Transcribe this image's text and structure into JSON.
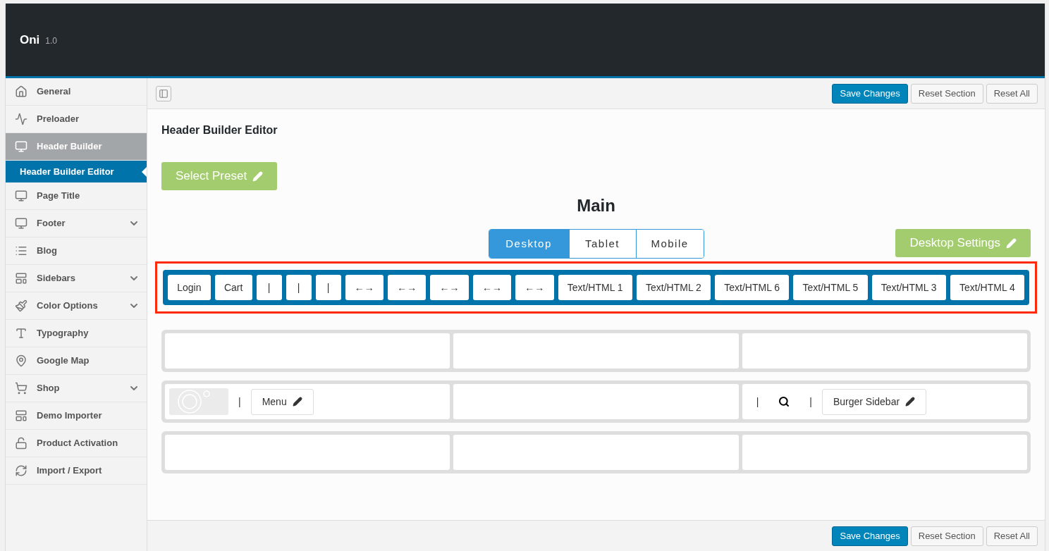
{
  "header": {
    "title": "Oni",
    "version": "1.0"
  },
  "sidebar": {
    "items": [
      {
        "label": "General",
        "kind": "home",
        "selected": false,
        "has_submenu": false
      },
      {
        "label": "Preloader",
        "kind": "chart",
        "selected": false,
        "has_submenu": false
      },
      {
        "label": "Header Builder",
        "kind": "monitor",
        "selected": true,
        "has_submenu": false,
        "children": [
          {
            "label": "Header Builder Editor",
            "selected": true
          }
        ]
      },
      {
        "label": "Page Title",
        "kind": "monitor",
        "selected": false,
        "has_submenu": false
      },
      {
        "label": "Footer",
        "kind": "monitor",
        "selected": false,
        "has_submenu": true
      },
      {
        "label": "Blog",
        "kind": "list",
        "selected": false,
        "has_submenu": false
      },
      {
        "label": "Sidebars",
        "kind": "layout",
        "selected": false,
        "has_submenu": true
      },
      {
        "label": "Color Options",
        "kind": "brush",
        "selected": false,
        "has_submenu": true
      },
      {
        "label": "Typography",
        "kind": "type",
        "selected": false,
        "has_submenu": false
      },
      {
        "label": "Google Map",
        "kind": "pin",
        "selected": false,
        "has_submenu": false
      },
      {
        "label": "Shop",
        "kind": "cart",
        "selected": false,
        "has_submenu": true
      },
      {
        "label": "Demo Importer",
        "kind": "layout",
        "selected": false,
        "has_submenu": false
      },
      {
        "label": "Product Activation",
        "kind": "unlock",
        "selected": false,
        "has_submenu": false
      },
      {
        "label": "Import / Export",
        "kind": "refresh",
        "selected": false,
        "has_submenu": false
      }
    ]
  },
  "top_actions": [
    "Save Changes",
    "Reset Section",
    "Reset All"
  ],
  "section_title": "Header Builder Editor",
  "preset_button": "Select Preset",
  "builder_title": "Main",
  "device_tabs": [
    {
      "label": "Desktop",
      "selected": true
    },
    {
      "label": "Tablet",
      "selected": false
    },
    {
      "label": "Mobile",
      "selected": false
    }
  ],
  "settings_button": "Desktop Settings",
  "available_elements": [
    "Login",
    "Cart",
    "|",
    "|",
    "|",
    "←→",
    "←→",
    "←→",
    "←→",
    "←→",
    "Text/HTML 1",
    "Text/HTML 2",
    "Text/HTML 6",
    "Text/HTML 5",
    "Text/HTML 3",
    "Text/HTML 4"
  ],
  "rows": [
    {
      "cells": [
        {},
        {},
        {}
      ]
    },
    {
      "cells": [
        {
          "items": [
            {
              "kind": "logo"
            },
            {
              "kind": "text",
              "label": "|"
            },
            {
              "kind": "button",
              "label": "Menu"
            }
          ]
        },
        {},
        {
          "items": [
            {
              "kind": "text",
              "label": "|"
            },
            {
              "kind": "search"
            },
            {
              "kind": "text",
              "label": "|"
            },
            {
              "kind": "button",
              "label": "Burger Sidebar"
            }
          ]
        }
      ]
    },
    {
      "cells": [
        {},
        {},
        {}
      ]
    }
  ],
  "bottom_actions": [
    "Save Changes",
    "Reset Section",
    "Reset All"
  ]
}
